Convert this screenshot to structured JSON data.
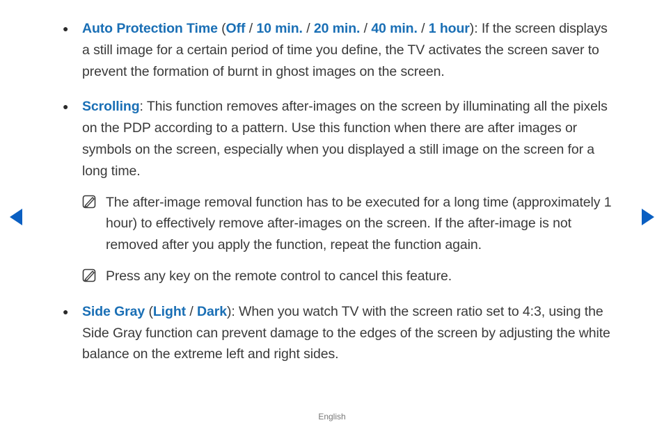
{
  "items": [
    {
      "keyword": "Auto Protection Time",
      "prefix_paren": " (",
      "options": [
        "Off",
        "10 min.",
        "20 min.",
        "40 min.",
        "1 hour"
      ],
      "option_sep": " / ",
      "suffix_paren": ")",
      "body": ": If the screen displays a still image for a certain period of time you define, the TV activates the screen saver to prevent the formation of burnt in ghost images on the screen."
    },
    {
      "keyword": "Scrolling",
      "body": ": This function removes after-images on the screen by illuminating all the pixels on the PDP according to a pattern. Use this function when there are after images or symbols on the screen, especially when you displayed a still image on the screen for a long time.",
      "notes": [
        "The after-image removal function has to be executed for a long time (approximately 1 hour) to effectively remove after-images on the screen. If the after-image is not removed after you apply the function, repeat the function again.",
        "Press any key on the remote control to cancel this feature."
      ]
    },
    {
      "keyword": "Side Gray",
      "prefix_paren": " (",
      "options": [
        "Light",
        "Dark"
      ],
      "option_sep": " / ",
      "suffix_paren": ")",
      "body": ": When you watch TV with the screen ratio set to 4:3, using the Side Gray function can prevent damage to the edges of the screen by adjusting the white balance on the extreme left and right sides."
    }
  ],
  "footer": "English"
}
